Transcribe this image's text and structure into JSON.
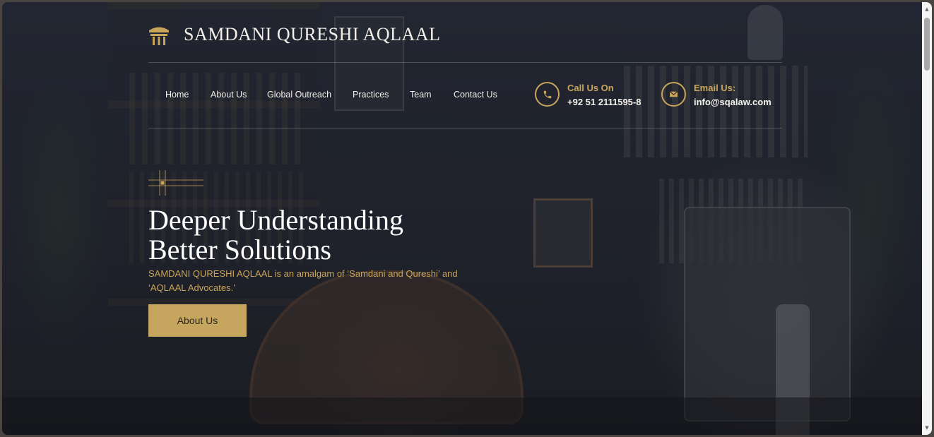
{
  "brand": {
    "name": "SAMDANI QURESHI AQLAAL",
    "logo_icon": "pillar-icon"
  },
  "nav": {
    "items": [
      {
        "label": "Home"
      },
      {
        "label": "About Us"
      },
      {
        "label": "Global Outreach"
      },
      {
        "label": "Practices"
      },
      {
        "label": "Team"
      },
      {
        "label": "Contact Us"
      }
    ]
  },
  "contact": {
    "phone": {
      "title": "Call Us On",
      "value": "+92 51 2111595-8",
      "icon": "phone-icon"
    },
    "email": {
      "title": "Email Us:",
      "value": "info@sqalaw.com",
      "icon": "envelope-icon"
    }
  },
  "hero": {
    "headline_line1": "Deeper Understanding",
    "headline_line2": "Better Solutions",
    "subtext": "SAMDANI QURESHI AQLAAL is an amalgam of ‘Samdani and Qureshi’ and ‘AQLAAL Advocates.’",
    "cta_label": "About Us"
  },
  "colors": {
    "accent": "#c9a55c",
    "button": "#c6a65e",
    "background": "#1f222b"
  }
}
